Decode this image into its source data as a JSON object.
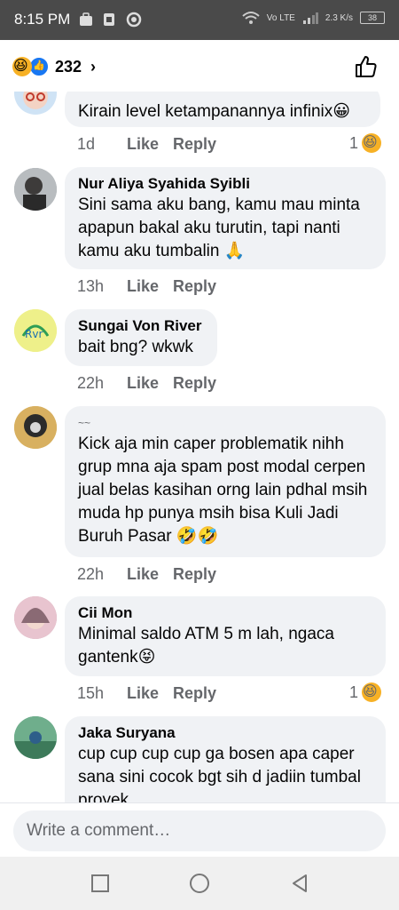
{
  "status_bar": {
    "time": "8:15 PM",
    "network": "Vo LTE",
    "speed": "2.3 K/s",
    "battery": "38"
  },
  "header": {
    "reaction_count": "232",
    "reactions": [
      "haha-icon",
      "like-icon"
    ]
  },
  "comments": [
    {
      "author": "",
      "text": "Kirain level ketampanannya infinix😀",
      "time": "1d",
      "like": "Like",
      "reply": "Reply",
      "reaction_count": "1"
    },
    {
      "author": "Nur Aliya Syahida Syibli",
      "text": "Sini sama aku bang, kamu mau minta apapun bakal aku turutin, tapi nanti kamu aku tumbalin 🙏",
      "time": "13h",
      "like": "Like",
      "reply": "Reply",
      "reaction_count": ""
    },
    {
      "author": "Sungai Von River",
      "text": "bait bng? wkwk",
      "time": "22h",
      "like": "Like",
      "reply": "Reply",
      "reaction_count": ""
    },
    {
      "author": "~~",
      "text": "Kick aja min caper problematik nihh grup mna aja spam post modal cerpen jual belas kasihan orng lain pdhal msih muda hp punya msih bisa Kuli Jadi Buruh Pasar 🤣🤣",
      "time": "22h",
      "like": "Like",
      "reply": "Reply",
      "reaction_count": ""
    },
    {
      "author": "Cii Mon",
      "text": "Minimal saldo ATM 5 m lah, ngaca gantenk😝",
      "time": "15h",
      "like": "Like",
      "reply": "Reply",
      "reaction_count": "1"
    },
    {
      "author": "Jaka Suryana",
      "text": "cup cup cup cup ga bosen apa caper sana sini cocok bgt sih d jadiin tumbal proyek",
      "time": "",
      "like": "",
      "reply": "",
      "reaction_count": ""
    }
  ],
  "composer": {
    "placeholder": "Write a comment…"
  },
  "colors": {
    "accent": "#1877f2",
    "bubble": "#f0f2f5",
    "muted": "#65676b",
    "status_bar": "#4a4a4a"
  }
}
